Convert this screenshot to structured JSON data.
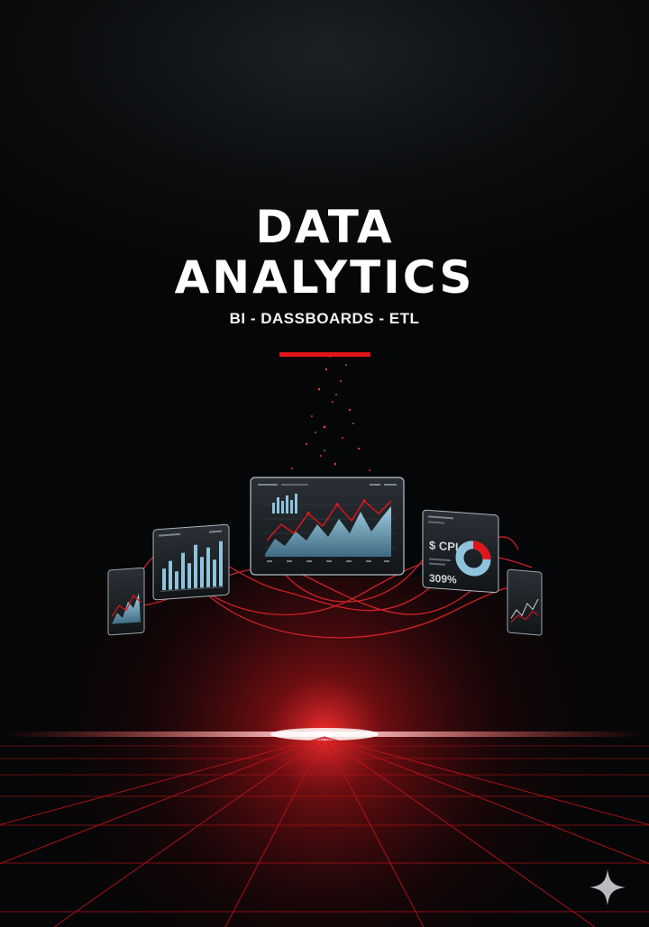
{
  "title_line_1": "DATA",
  "title_line_2": "ANALYTICS",
  "subtitle": "BI - DASSBOARDS - ETL",
  "screens": {
    "right_kpi_label": "$ CPI",
    "right_kpi_value": "309%"
  },
  "colors": {
    "accent": "#e3141b",
    "background": "#060708",
    "chart_fill": "#8fc3dc"
  },
  "icons": {
    "corner": "sparkle-icon"
  }
}
